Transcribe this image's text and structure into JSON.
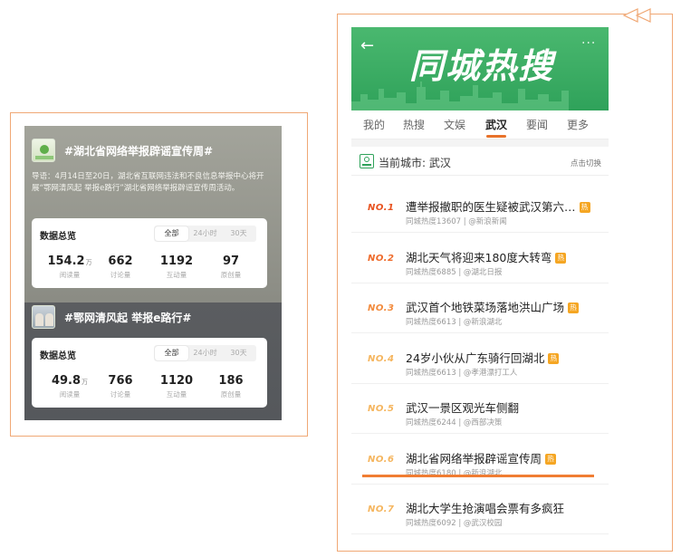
{
  "left_panel": {
    "topic1": {
      "title": "#湖北省网络举报辟谣宣传周#",
      "lead": "导语：4月14日至20日，湖北省互联网违法和不良信息举报中心将开展“鄂网清风起 举报e路行”湖北省网络举报辟谣宣传周活动。",
      "stats": {
        "title": "数据总览",
        "tabs": [
          "全部",
          "24小时",
          "30天"
        ],
        "metrics": [
          {
            "value": "154.2",
            "unit": "万",
            "label": "阅读量"
          },
          {
            "value": "662",
            "unit": "",
            "label": "讨论量"
          },
          {
            "value": "1192",
            "unit": "",
            "label": "互动量"
          },
          {
            "value": "97",
            "unit": "",
            "label": "原创量"
          }
        ]
      }
    },
    "topic2": {
      "title": "#鄂网清风起 举报e路行#",
      "stats": {
        "title": "数据总览",
        "tabs": [
          "全部",
          "24小时",
          "30天"
        ],
        "metrics": [
          {
            "value": "49.8",
            "unit": "万",
            "label": "阅读量"
          },
          {
            "value": "766",
            "unit": "",
            "label": "讨论量"
          },
          {
            "value": "1120",
            "unit": "",
            "label": "互动量"
          },
          {
            "value": "186",
            "unit": "",
            "label": "原创量"
          }
        ]
      }
    }
  },
  "right_panel": {
    "banner": {
      "title": "同城热搜",
      "more": "···",
      "back": "←",
      "color": "#2fa25a"
    },
    "tabs": [
      "我的",
      "热搜",
      "文娱",
      "武汉",
      "要闻",
      "更多"
    ],
    "active_tab": "武汉",
    "city": {
      "label": "当前城市: 武汉",
      "switch": "点击切换"
    },
    "hot_badge": "热",
    "items": [
      {
        "no": "NO.1",
        "title": "遭举报撤职的医生疑被武汉第六…",
        "hot": true,
        "sub": "同城热度13607 | @新浪新闻",
        "color": "#e8521f"
      },
      {
        "no": "NO.2",
        "title": "湖北天气将迎来180度大转弯",
        "hot": true,
        "sub": "同城热度6885 | @湖北日报",
        "color": "#ee6a2a"
      },
      {
        "no": "NO.3",
        "title": "武汉首个地铁菜场落地洪山广场",
        "hot": true,
        "sub": "同城热度6613 | @新浪湖北",
        "color": "#f28a3c"
      },
      {
        "no": "NO.4",
        "title": "24岁小伙从广东骑行回湖北",
        "hot": true,
        "sub": "同城热度6613 | @孝港漂打工人",
        "color": "#f5b55e"
      },
      {
        "no": "NO.5",
        "title": "武汉一景区观光车侧翻",
        "hot": false,
        "sub": "同城热度6244 | @西部决策",
        "color": "#f5b55e"
      },
      {
        "no": "NO.6",
        "title": "湖北省网络举报辟谣宣传周",
        "hot": true,
        "sub": "同城热度6180 | @新浪湖北",
        "color": "#f5b55e"
      },
      {
        "no": "NO.7",
        "title": "湖北大学生抢演唱会票有多疯狂",
        "hot": false,
        "sub": "同城热度6092 | @武汉校园",
        "color": "#f5b55e"
      }
    ]
  },
  "accent_color": "#f07d33"
}
